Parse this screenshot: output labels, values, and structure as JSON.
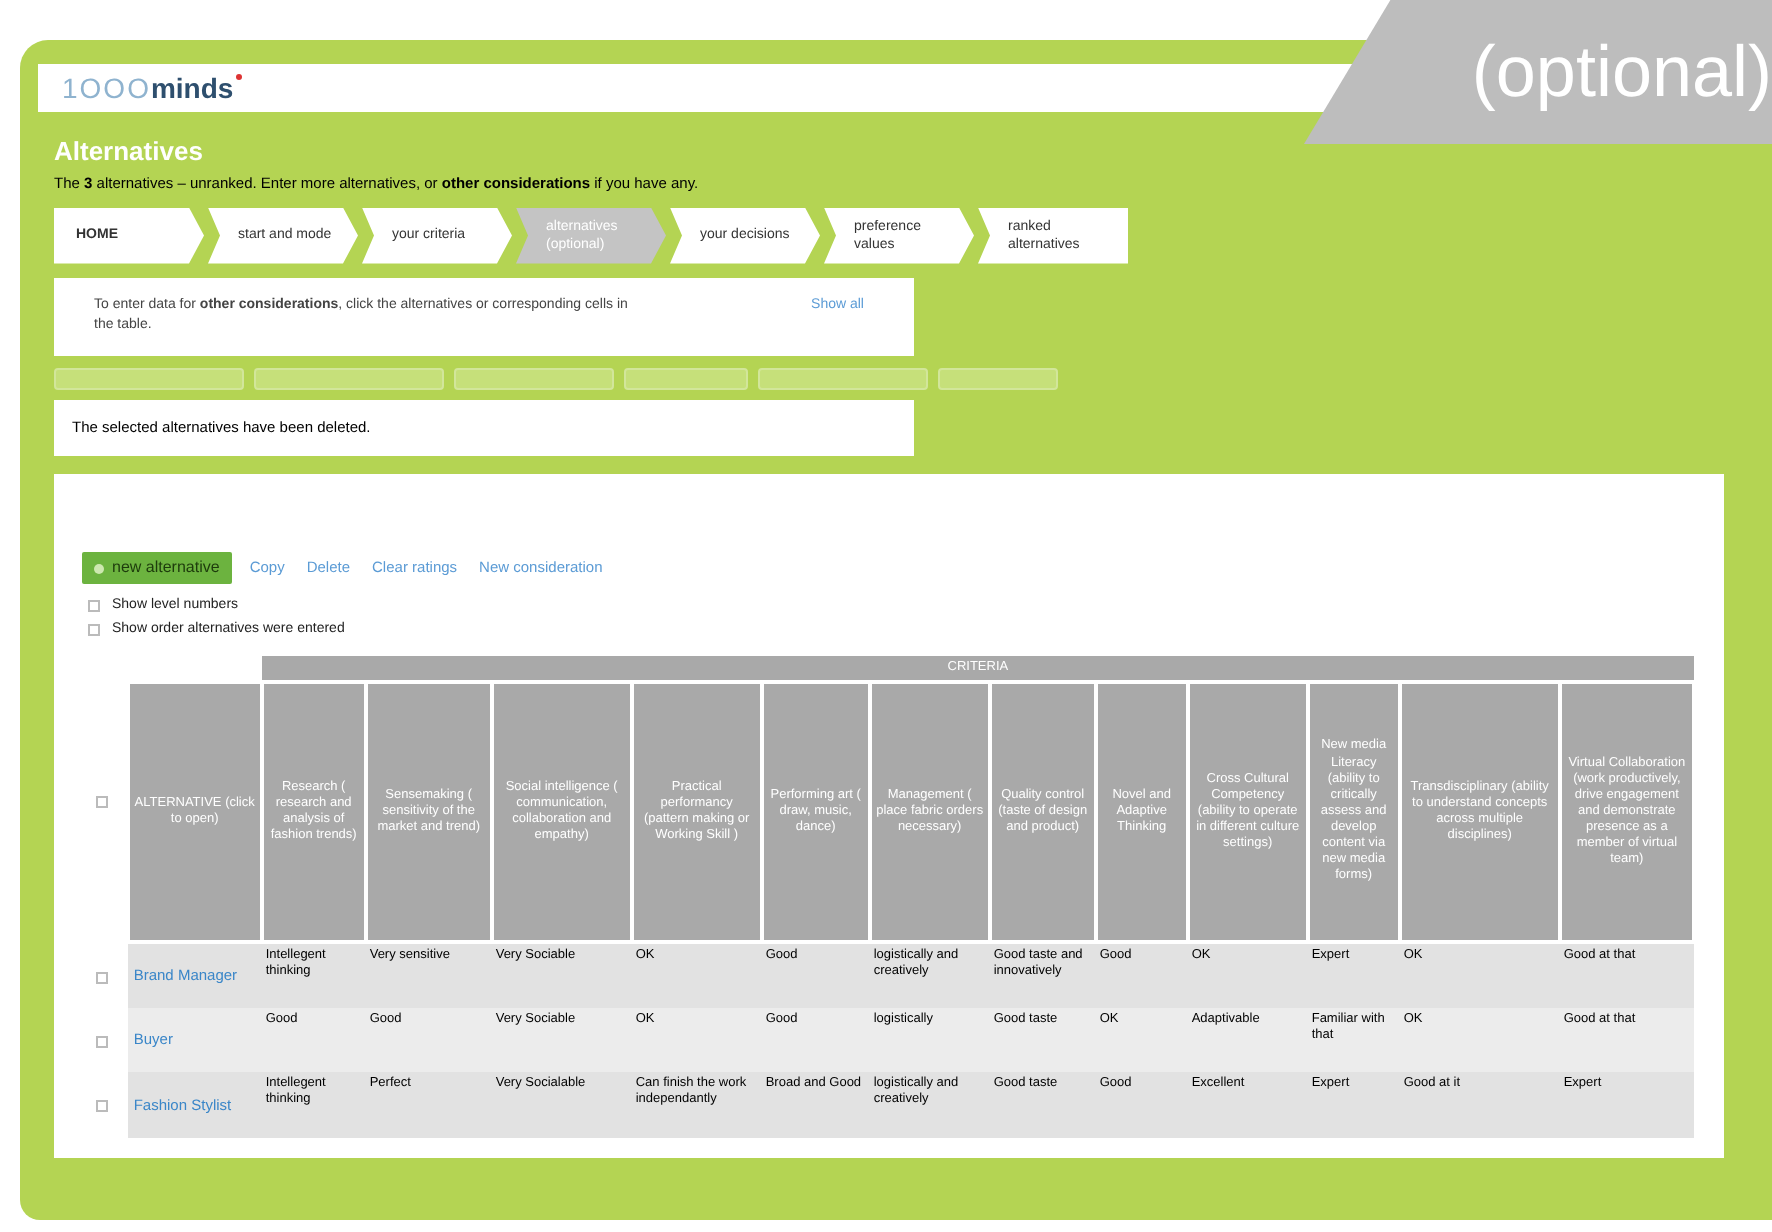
{
  "header": {
    "logo_light": "1OOO",
    "logo_bold": "minds",
    "callout": "(optional)"
  },
  "page": {
    "title": "Alternatives",
    "subtitle": "The **3** alternatives – unranked. Enter more alternatives, or **other considerations** if you have any."
  },
  "steps": [
    {
      "label": "HOME",
      "selected": false
    },
    {
      "label": "start and mode",
      "selected": false
    },
    {
      "label": "your criteria",
      "selected": false
    },
    {
      "label": "alternatives (optional)",
      "selected": true
    },
    {
      "label": "your decisions",
      "selected": false
    },
    {
      "label": "preference values",
      "selected": false
    },
    {
      "label": "ranked alternatives",
      "selected": false
    }
  ],
  "info": {
    "text": "To enter data for **other considerations**, click the alternatives or corresponding cells in the table.",
    "link": "Show all"
  },
  "message": "The selected alternatives have been deleted.",
  "actions": {
    "primary": "new alternative",
    "links": [
      "Copy",
      "Delete",
      "Clear ratings",
      "New consideration"
    ]
  },
  "options": [
    {
      "label": "Show level numbers",
      "checked": false
    },
    {
      "label": "Show order alternatives were entered",
      "checked": false
    }
  ],
  "table": {
    "select_all_checked": false,
    "group_header": "CRITERIA",
    "alternative_header": "ALTERNATIVE (click to open)",
    "columns": [
      "Research ( research and analysis of fashion trends)",
      "Sensemaking ( sensitivity of the market and trend)",
      "Social intelligence ( communication, collaboration and empathy)",
      "Practical performancy (pattern making or Working Skill )",
      "Performing art ( draw, music, dance)",
      "Management ( place fabric orders necessary)",
      "Quality control (taste of design and product)",
      "Novel and Adaptive Thinking",
      "Cross Cultural Competency (ability to operate in different culture settings)",
      "New media Literacy (ability to critically assess and develop content via new media forms)",
      "Transdisciplinary (ability to understand concepts across multiple disciplines)",
      "Virtual Collaboration (work productively, drive engagement and demonstrate presence as a member of virtual team)"
    ],
    "rows": [
      {
        "name": "Brand Manager",
        "checked": false,
        "cells": [
          "Intellegent thinking",
          "Very sensitive",
          "Very Sociable",
          "OK",
          "Good",
          "logistically and creatively",
          "Good taste and innovatively",
          "Good",
          "OK",
          "Expert",
          "OK",
          "Good at that"
        ]
      },
      {
        "name": "Buyer",
        "checked": false,
        "cells": [
          "Good",
          "Good",
          "Very Sociable",
          "OK",
          "Good",
          "logistically",
          "Good taste",
          "OK",
          "Adaptivable",
          "Familiar with that",
          "OK",
          "Good at that"
        ]
      },
      {
        "name": "Fashion Stylist",
        "checked": false,
        "cells": [
          "Intellegent thinking",
          "Perfect",
          "Very Socialable",
          "Can finish the work independantly",
          "Broad and Good",
          "logistically and creatively",
          "Good taste",
          "Good",
          "Excellent",
          "Expert",
          "Good at it",
          "Expert"
        ]
      }
    ]
  }
}
